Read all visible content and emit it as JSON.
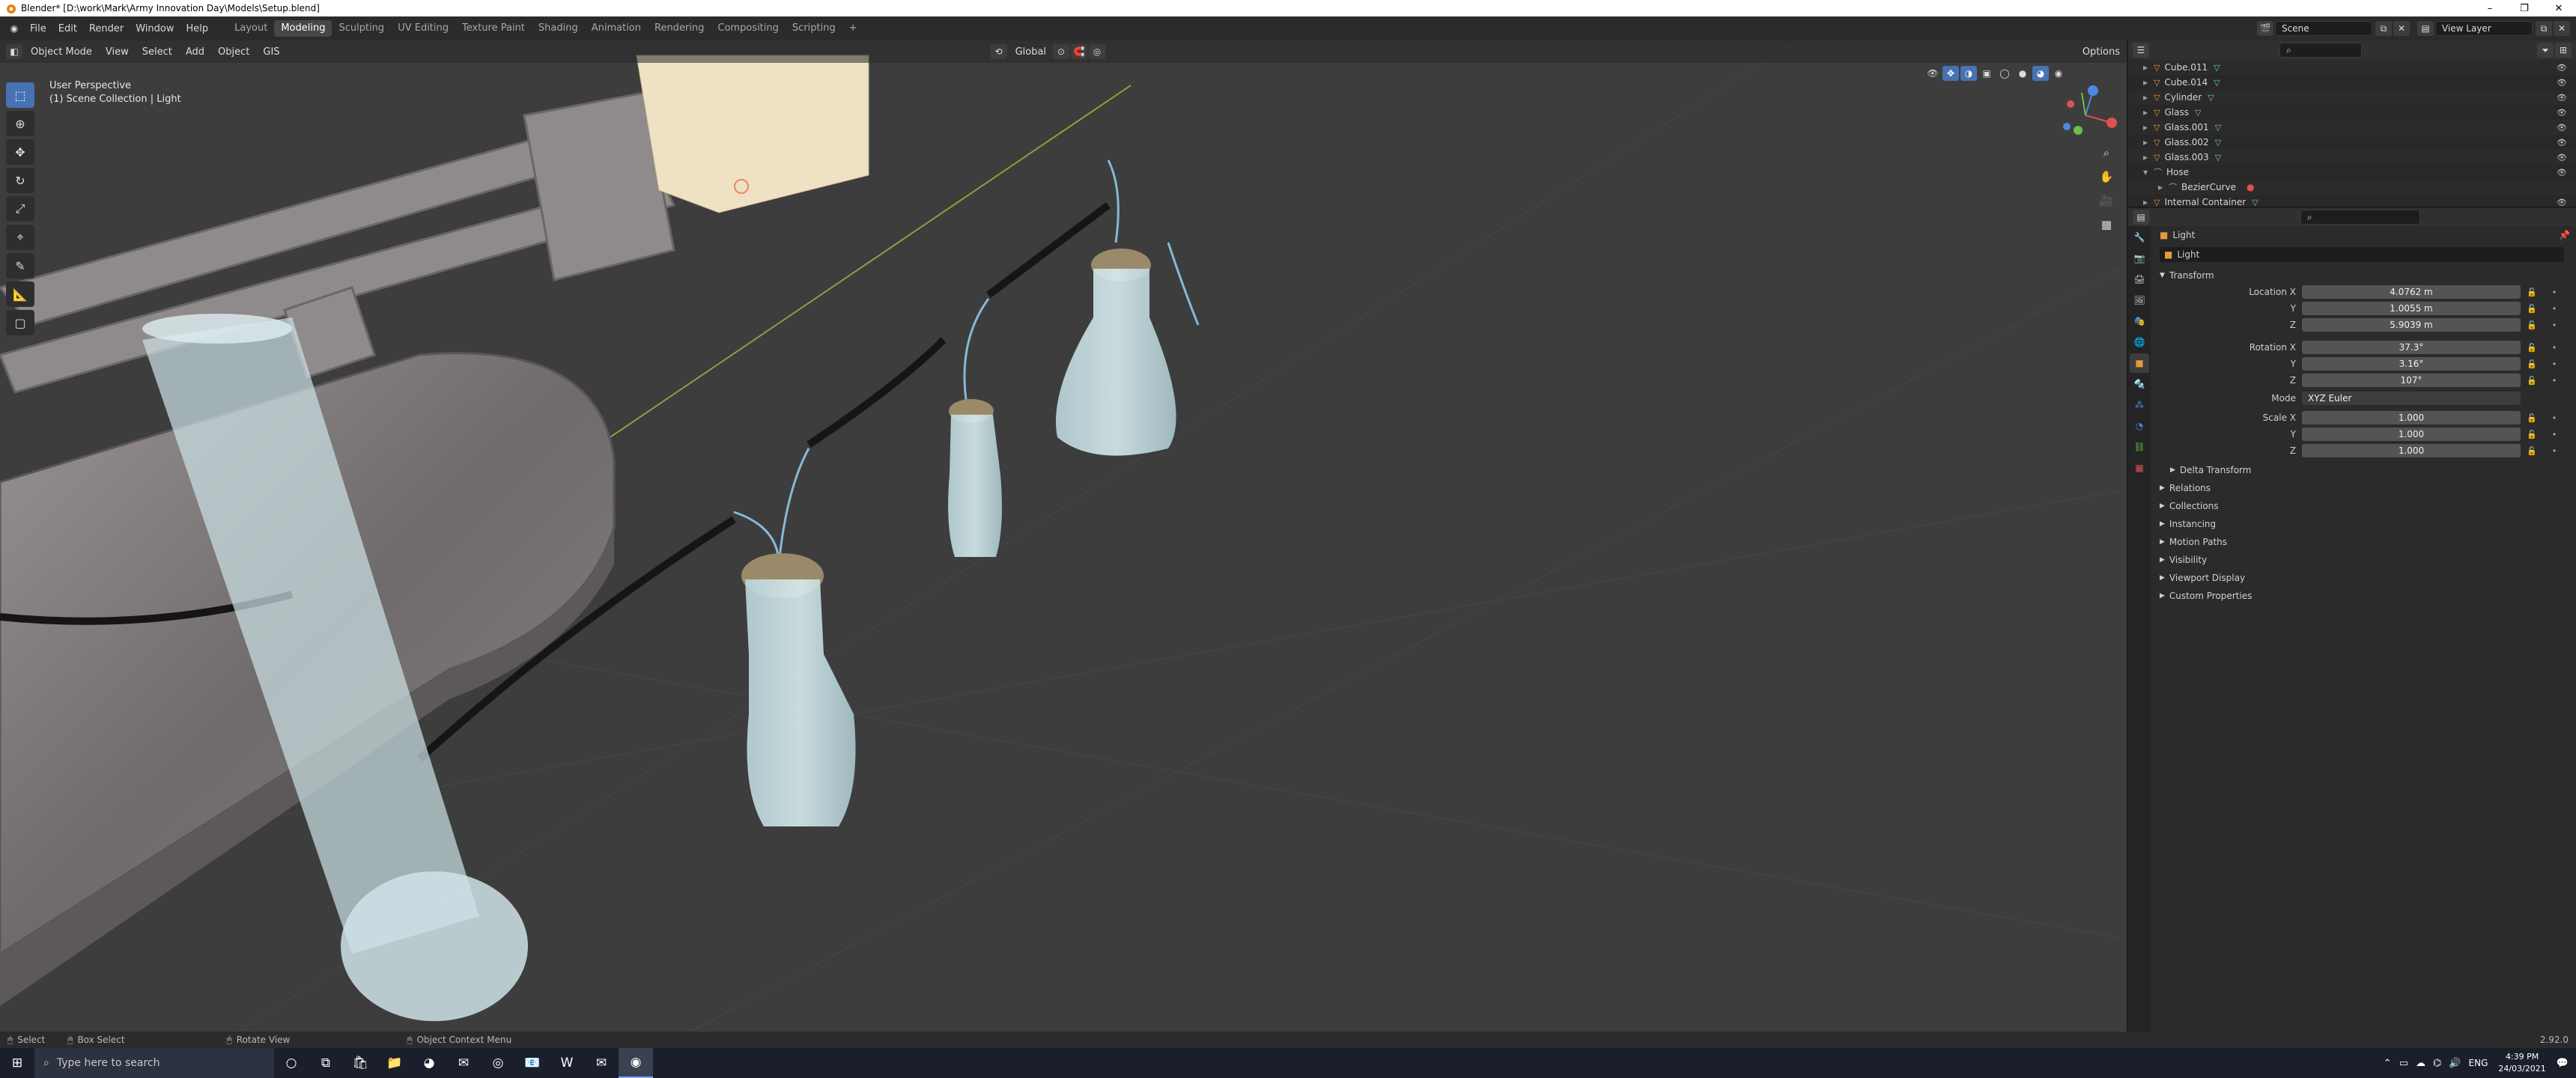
{
  "window": {
    "title": "Blender* [D:\\work\\Mark\\Army Innovation Day\\Models\\Setup.blend]"
  },
  "topbar": {
    "menus": [
      "File",
      "Edit",
      "Render",
      "Window",
      "Help"
    ],
    "workspaces": [
      "Layout",
      "Modeling",
      "Sculpting",
      "UV Editing",
      "Texture Paint",
      "Shading",
      "Animation",
      "Rendering",
      "Compositing",
      "Scripting"
    ],
    "active_workspace": "Modeling",
    "scene": "Scene",
    "view_layer": "View Layer"
  },
  "viewport": {
    "mode": "Object Mode",
    "menus": [
      "View",
      "Select",
      "Add",
      "Object",
      "GIS"
    ],
    "transform_orientation": "Global",
    "options_label": "Options",
    "perspective": "User Perspective",
    "collection_info": "(1) Scene Collection | Light"
  },
  "outliner": {
    "search_placeholder": "",
    "items": [
      {
        "name": "Cube.011",
        "indent": 0
      },
      {
        "name": "Cube.014",
        "indent": 0
      },
      {
        "name": "Cylinder",
        "indent": 0
      },
      {
        "name": "Glass",
        "indent": 0
      },
      {
        "name": "Glass.001",
        "indent": 0
      },
      {
        "name": "Glass.002",
        "indent": 0
      },
      {
        "name": "Glass.003",
        "indent": 0
      },
      {
        "name": "Hose",
        "indent": 0
      },
      {
        "name": "BezierCurve",
        "indent": 1
      },
      {
        "name": "Internal Container",
        "indent": 0
      }
    ]
  },
  "properties": {
    "object_name_header": "Light",
    "object_name": "Light",
    "transform_label": "Transform",
    "location": {
      "label_x": "Location X",
      "x": "4.0762 m",
      "y": "1.0055 m",
      "z": "5.9039 m"
    },
    "rotation": {
      "label_x": "Rotation X",
      "x": "37.3°",
      "y": "3.16°",
      "z": "107°"
    },
    "mode_label": "Mode",
    "mode_value": "XYZ Euler",
    "scale": {
      "label_x": "Scale X",
      "x": "1.000",
      "y": "1.000",
      "z": "1.000"
    },
    "axis_y": "Y",
    "axis_z": "Z",
    "delta_transform": "Delta Transform",
    "sections": [
      "Relations",
      "Collections",
      "Instancing",
      "Motion Paths",
      "Visibility",
      "Viewport Display",
      "Custom Properties"
    ]
  },
  "statusbar": {
    "select": "Select",
    "box_select": "Box Select",
    "rotate_view": "Rotate View",
    "context_menu": "Object Context Menu",
    "version": "2.92.0"
  },
  "taskbar": {
    "search_placeholder": "Type here to search",
    "language": "ENG",
    "time": "4:39 PM",
    "date": "24/03/2021"
  },
  "colors": {
    "accent": "#4772b3",
    "object_orange": "#e59a3c",
    "mesh_green": "#6fcf97"
  }
}
